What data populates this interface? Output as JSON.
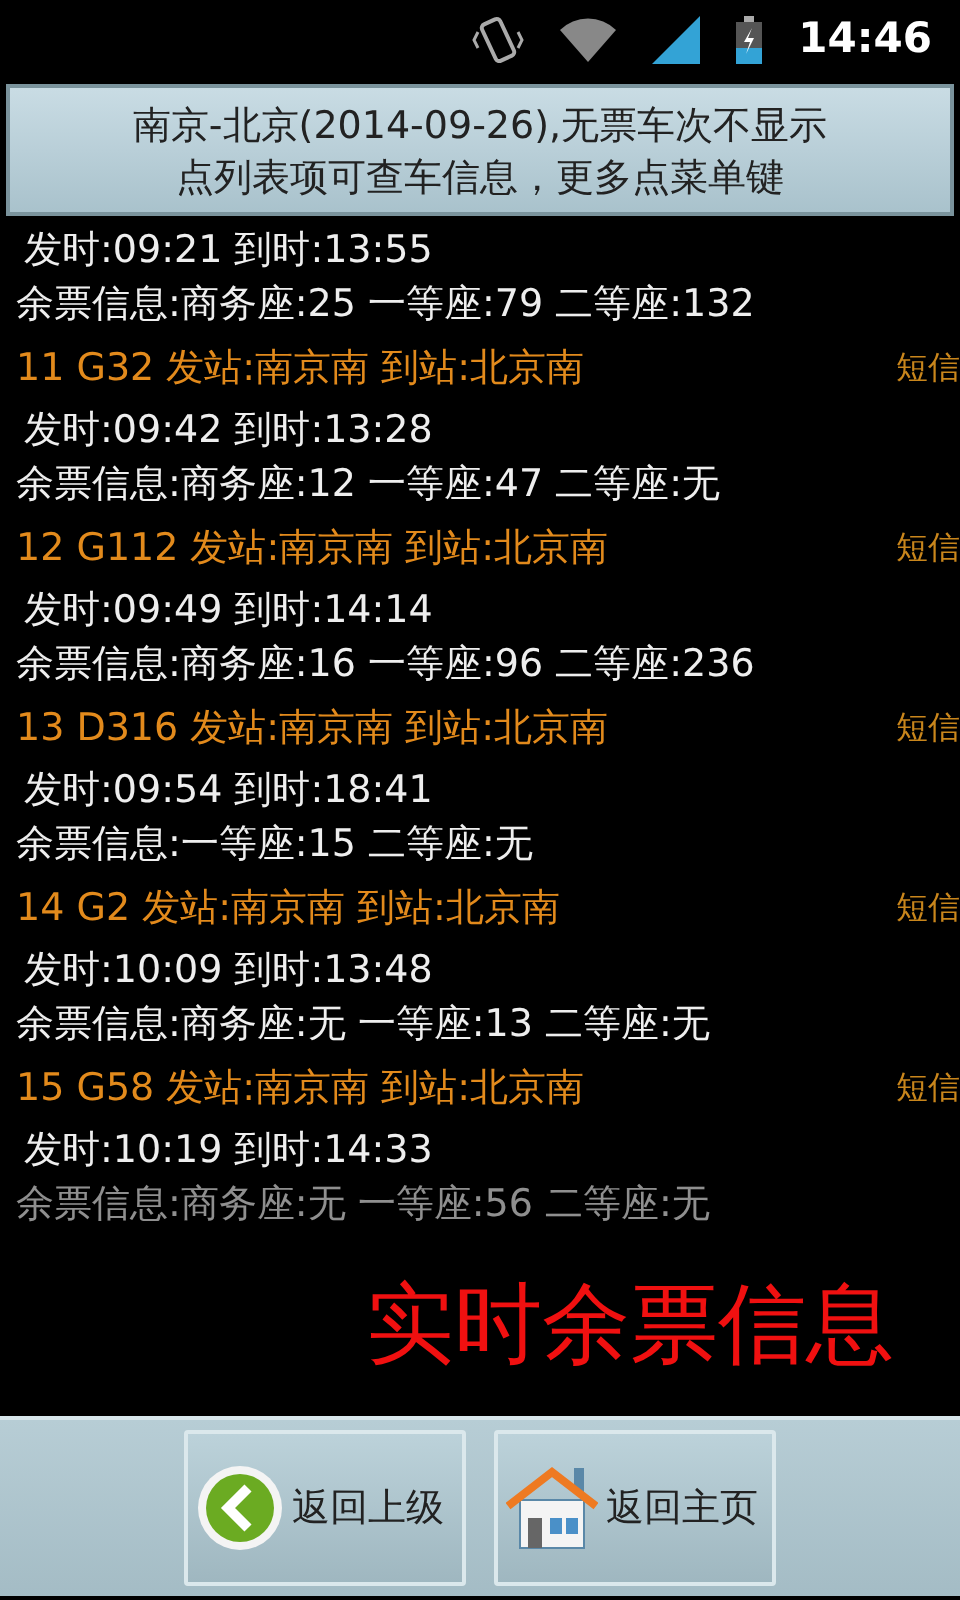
{
  "status_bar": {
    "time": "14:46"
  },
  "banner": {
    "lines": [
      "南京-北京(2014-09-26),无票车次不显示",
      "点列表项可查车信息，更多点菜单键"
    ]
  },
  "first_partial": {
    "times": "发时:09:21 到时:13:55",
    "seats": "余票信息:商务座:25 一等座:79 二等座:132"
  },
  "trains": [
    {
      "header": "11 G32 发站:南京南 到站:北京南",
      "sms": "短信",
      "times": "发时:09:42 到时:13:28",
      "seats": "余票信息:商务座:12 一等座:47 二等座:无"
    },
    {
      "header": "12 G112 发站:南京南 到站:北京南",
      "sms": "短信",
      "times": "发时:09:49 到时:14:14",
      "seats": "余票信息:商务座:16 一等座:96 二等座:236"
    },
    {
      "header": "13 D316 发站:南京南 到站:北京南",
      "sms": "短信",
      "times": "发时:09:54 到时:18:41",
      "seats": "余票信息:一等座:15 二等座:无"
    },
    {
      "header": "14 G2 发站:南京南 到站:北京南",
      "sms": "短信",
      "times": "发时:10:09 到时:13:48",
      "seats": "余票信息:商务座:无 一等座:13 二等座:无"
    },
    {
      "header": "15 G58 发站:南京南 到站:北京南",
      "sms": "短信",
      "times": "发时:10:19 到时:14:33",
      "seats": "余票信息:商务座:无 一等座:56 二等座:无"
    }
  ],
  "caption": "实时余票信息",
  "buttons": [
    {
      "kind": "back",
      "label": "返回上级"
    },
    {
      "kind": "home",
      "label": "返回主页"
    }
  ]
}
